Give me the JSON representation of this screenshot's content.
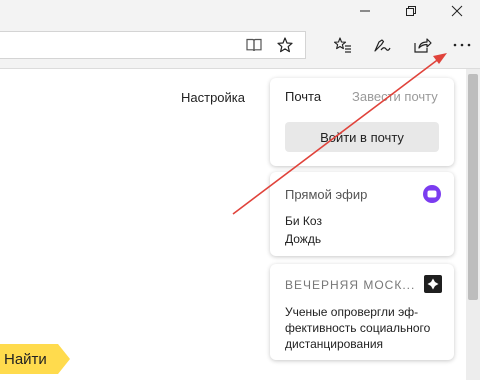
{
  "header": {
    "settings_label": "Настройка"
  },
  "mail_card": {
    "title": "Почта",
    "create_link": "Завести почту",
    "login_button": "Войти в почту"
  },
  "live_card": {
    "title": "Прямой эфир",
    "line1": "Би Коз",
    "line2": "Дождь"
  },
  "news_card": {
    "source": "ВЕЧЕРНЯЯ МОСК...",
    "headline": "Ученые опровергли эф-фективность социального дистанцирования"
  },
  "search": {
    "button_label": "Найти"
  },
  "colors": {
    "accent_yellow": "#ffdb4d",
    "live_badge": "#7b3cf0",
    "annotation_arrow": "#e0433b"
  },
  "icons": {
    "window": [
      "minimize-icon",
      "restore-icon",
      "close-icon"
    ],
    "toolbar": [
      "reading-view-icon",
      "favorite-star-icon",
      "favorites-hub-icon",
      "pen-icon",
      "share-icon",
      "more-icon"
    ]
  }
}
